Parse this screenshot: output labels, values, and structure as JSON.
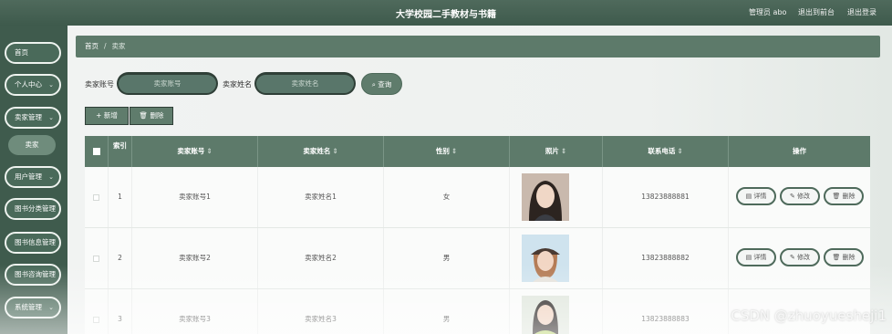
{
  "header": {
    "title": "大学校园二手教材与书籍",
    "user_label": "管理员 abo",
    "back_label": "退出到前台",
    "logout_label": "退出登录"
  },
  "sidebar": {
    "items": [
      {
        "label": "首页"
      },
      {
        "label": "个人中心"
      },
      {
        "label": "卖家管理"
      },
      {
        "label": "卖家"
      },
      {
        "label": "用户管理"
      },
      {
        "label": "图书分类管理"
      },
      {
        "label": "图书信息管理"
      },
      {
        "label": "图书咨询管理"
      },
      {
        "label": "系统管理"
      }
    ]
  },
  "breadcrumb": {
    "home": "首页",
    "separator": "/",
    "current": "卖家"
  },
  "search": {
    "account_label": "卖家账号",
    "account_placeholder": "卖家账号",
    "name_label": "卖家姓名",
    "name_placeholder": "卖家姓名",
    "query_label": "查询",
    "query_icon": "search-icon"
  },
  "actions": {
    "add_label": "+ 新增",
    "delete_label": "删除"
  },
  "table": {
    "headers": {
      "index": "索引",
      "account": "卖家账号",
      "name": "卖家姓名",
      "gender": "性别",
      "photo": "照片",
      "phone": "联系电话",
      "ops": "操作"
    },
    "sort_glyph": "⇕",
    "rows": [
      {
        "index": "1",
        "account": "卖家账号1",
        "name": "卖家姓名1",
        "gender": "女",
        "phone": "13823888881"
      },
      {
        "index": "2",
        "account": "卖家账号2",
        "name": "卖家姓名2",
        "gender": "男",
        "phone": "13823888882"
      },
      {
        "index": "3",
        "account": "卖家账号3",
        "name": "卖家姓名3",
        "gender": "男",
        "phone": "13823888883"
      }
    ],
    "row_ops": {
      "detail": "详情",
      "edit": "修改",
      "delete": "删除"
    }
  },
  "watermark": "CSDN @zhuoyuesheji1",
  "colors": {
    "primary": "#5d7a6a",
    "sidebar": "#3f5b4d",
    "header": "#4f6a5c"
  }
}
